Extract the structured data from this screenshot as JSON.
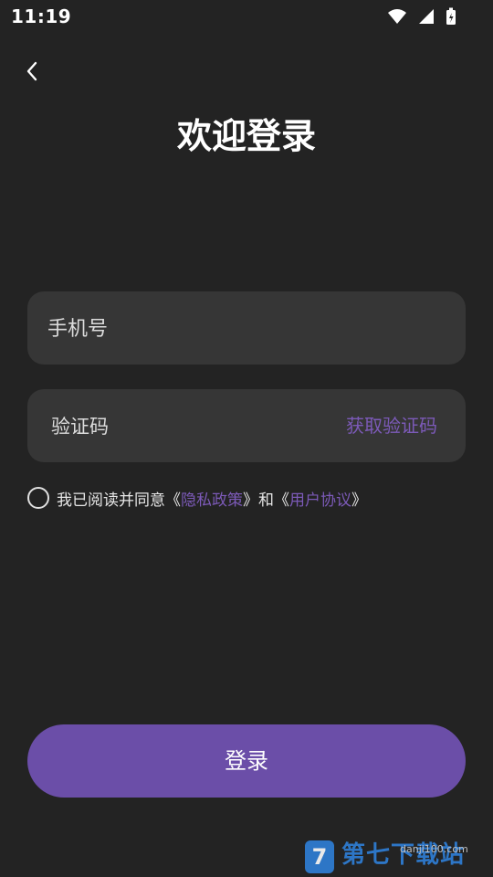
{
  "status_bar": {
    "time": "11:19"
  },
  "header": {
    "title": "欢迎登录"
  },
  "form": {
    "phone_placeholder": "手机号",
    "code_placeholder": "验证码",
    "get_code_label": "获取验证码"
  },
  "agreement": {
    "prefix": "我已阅读并同意",
    "open_quote": "《",
    "close_quote": "》",
    "privacy_label": "隐私政策",
    "conjunction": "和",
    "terms_label": "用户协议",
    "checked": false
  },
  "actions": {
    "login_label": "登录"
  },
  "watermark": {
    "text": "第七下载站",
    "sub": "danji100.com"
  },
  "colors": {
    "background": "#232323",
    "field": "#363636",
    "accent": "#6b4ea8",
    "link": "#7c5ab8"
  }
}
